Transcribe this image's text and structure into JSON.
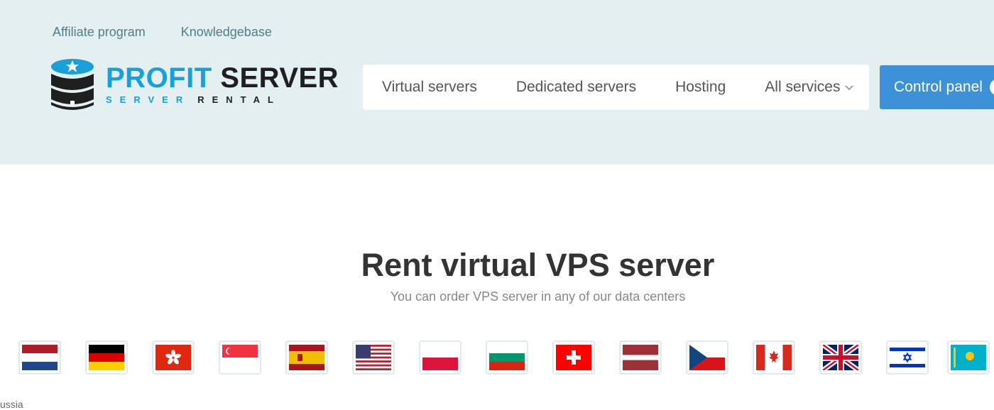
{
  "top_links": [
    "Affiliate program",
    "Knowledgebase"
  ],
  "logo": {
    "brand_part1": "PROFIT",
    "brand_part2": "SERVER",
    "tag_part1": "SERVER",
    "tag_part2": "RENTAL"
  },
  "nav": {
    "items": [
      "Virtual servers",
      "Dedicated servers",
      "Hosting",
      "All services"
    ]
  },
  "control_panel": "Control panel",
  "hero": {
    "title": "Rent virtual VPS server",
    "subtitle": "You can order VPS server in any of our data centers"
  },
  "flags": [
    "netherlands-flag",
    "germany-flag",
    "hong-kong-flag",
    "singapore-flag",
    "spain-flag",
    "usa-flag",
    "poland-flag",
    "bulgaria-flag",
    "switzerland-flag",
    "latvia-flag",
    "czech-flag",
    "canada-flag",
    "uk-flag",
    "israel-flag",
    "kazakhstan-flag"
  ],
  "location_label": "ussia",
  "colors": {
    "header_bg": "#e3eff0",
    "accent": "#3d91d6",
    "brand_blue": "#1a9fd9"
  }
}
